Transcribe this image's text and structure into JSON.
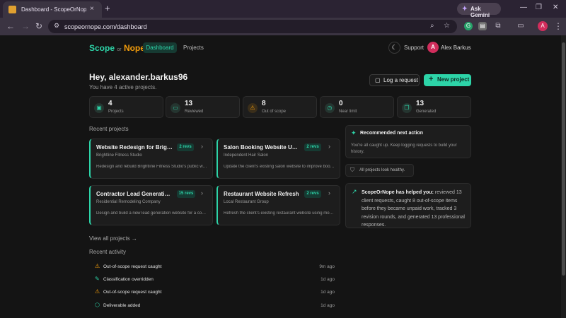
{
  "browser": {
    "tab_title": "Dashboard - ScopeOrNope — S",
    "tab_close": "×",
    "new_tab": "+",
    "gemini_label": "Ask Gemini",
    "url": "scopeornope.com/dashboard",
    "profile_initial": "A"
  },
  "nav": {
    "logo_scope": "Scope",
    "logo_or": "or",
    "logo_nope": "Nope",
    "dashboard": "Dashboard",
    "projects": "Projects",
    "support": "Support",
    "avatar_initial": "A",
    "user_name": "Alex Barkus"
  },
  "header": {
    "greeting": "Hey, alexander.barkus96",
    "subtitle": "You have 4 active projects.",
    "log_request": "Log a request",
    "new_project": "New project"
  },
  "stats": [
    {
      "value": "4",
      "label": "Projects",
      "icon": "briefcase-icon",
      "color": "#2dd4a8"
    },
    {
      "value": "13",
      "label": "Reviewed",
      "icon": "message-icon",
      "color": "#2dd4a8"
    },
    {
      "value": "8",
      "label": "Out of scope",
      "icon": "warning-icon",
      "color": "#f59e0b"
    },
    {
      "value": "0",
      "label": "Near limit",
      "icon": "clock-icon",
      "color": "#2dd4a8"
    },
    {
      "value": "13",
      "label": "Generated",
      "icon": "copy-icon",
      "color": "#2dd4a8"
    }
  ],
  "recent_projects_title": "Recent projects",
  "projects": [
    {
      "title": "Website Redesign for Brightline Fitness Studio",
      "badge": "2 revs",
      "client": "Brightline Fitness Studio",
      "desc": "Redesign and rebuild Brightline Fitness Studio's public website"
    },
    {
      "title": "Salon Booking Website Update",
      "badge": "2 revs",
      "client": "Independent Hair Salon",
      "desc": "Update the client's existing salon website to improve booking"
    },
    {
      "title": "Contractor Lead Generation Website",
      "badge": "15 revs",
      "client": "Residential Remodeling Company",
      "desc": "Design and build a new lead generation website for a contractor"
    },
    {
      "title": "Restaurant Website Refresh",
      "badge": "2 revs",
      "client": "Local Restaurant Group",
      "desc": "Refresh the client's existing restaurant website using modern design"
    }
  ],
  "recommended": {
    "title": "Recommended next action",
    "text": "You're all caught up. Keep logging requests to build your history."
  },
  "health": "All projects look healthy.",
  "help": {
    "lead": "ScopeOrNope has helped you:",
    "text": " reviewed 13 client requests, caught 8 out-of-scope items before they became unpaid work, tracked 3 revision rounds, and generated 13 professional responses."
  },
  "view_all": "View all projects →",
  "recent_activity_title": "Recent activity",
  "activity": [
    {
      "text": "Out-of-scope request caught",
      "time": "9m ago",
      "icon": "warning-icon",
      "color": "#f59e0b"
    },
    {
      "text": "Classification overridden",
      "time": "1d ago",
      "icon": "pencil-icon",
      "color": "#2dd4a8"
    },
    {
      "text": "Out-of-scope request caught",
      "time": "1d ago",
      "icon": "warning-icon",
      "color": "#f59e0b"
    },
    {
      "text": "Deliverable added",
      "time": "1d ago",
      "icon": "cube-icon",
      "color": "#2dd4a8"
    }
  ]
}
